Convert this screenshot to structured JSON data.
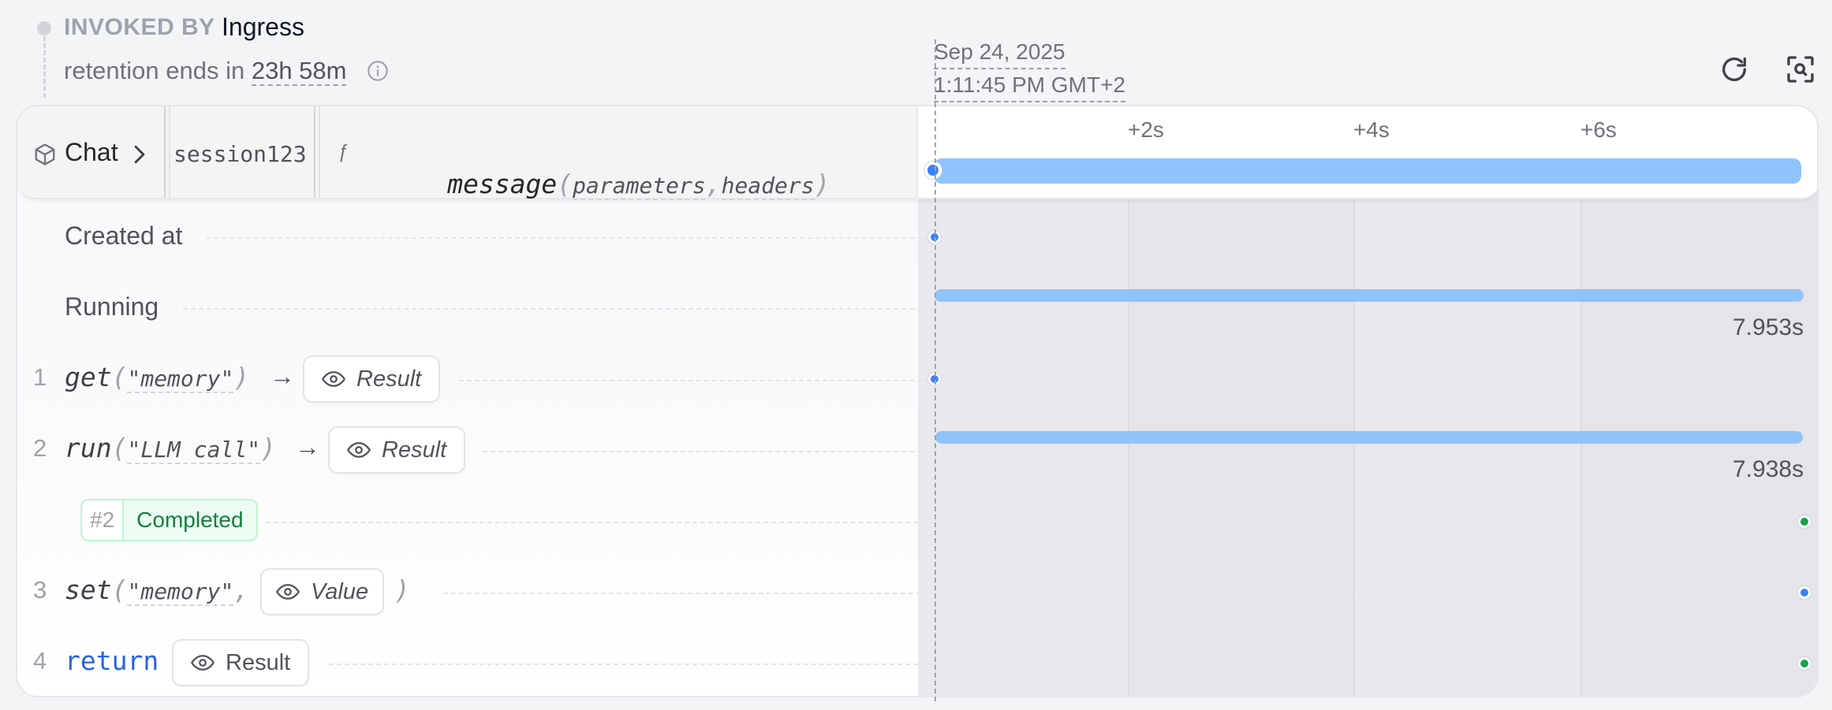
{
  "header": {
    "invoked_by_label": "INVOKED BY",
    "invoked_by_value": "Ingress",
    "retention_prefix": "retention ends in",
    "retention_value": "23h 58m"
  },
  "timeline": {
    "date": "Sep 24, 2025",
    "time": "1:11:45 PM GMT+2",
    "ticks": [
      "+2s",
      "+4s",
      "+6s"
    ]
  },
  "invocation": {
    "service": "Chat",
    "key": "session123",
    "fn_symbol": "ƒ",
    "handler": "message",
    "params": [
      "parameters",
      "headers"
    ]
  },
  "rows": {
    "created_label": "Created at",
    "running_label": "Running",
    "running_duration": "7.953s",
    "step1": {
      "num": "1",
      "fn": "get",
      "arg": "\"memory\"",
      "result_label": "Result"
    },
    "step2": {
      "num": "2",
      "fn": "run",
      "arg": "\"LLM call\"",
      "result_label": "Result",
      "duration": "7.938s"
    },
    "completed_badge": {
      "num": "#2",
      "label": "Completed"
    },
    "step3": {
      "num": "3",
      "fn": "set",
      "arg": "\"memory\"",
      "value_label": "Value"
    },
    "step4": {
      "num": "4",
      "keyword": "return",
      "result_label": "Result"
    }
  },
  "colors": {
    "bar": "#8fc3fb",
    "dot_blue": "#3b82f6",
    "dot_green": "#16a34a",
    "return_keyword": "#2563eb",
    "completed_text": "#15803d"
  }
}
